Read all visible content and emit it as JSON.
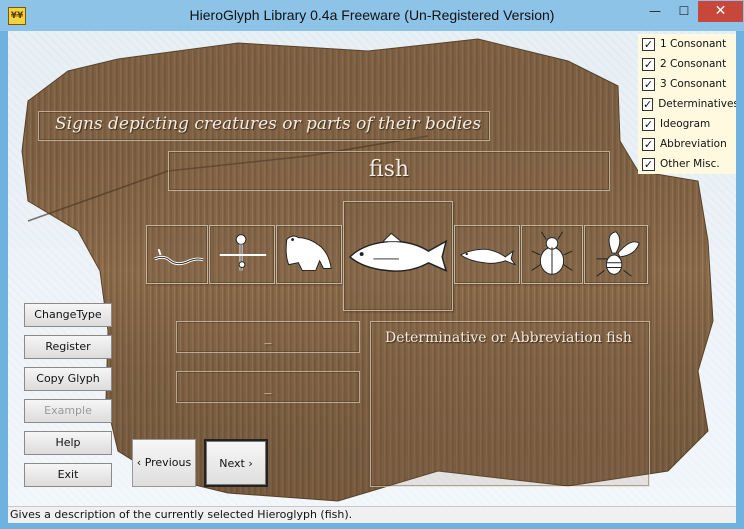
{
  "window": {
    "title": "HieroGlyph Library 0.4a Freeware (Un-Registered Version)",
    "icon_text": "¥¥",
    "minimize": "—",
    "maximize": "☐",
    "close": "✕"
  },
  "category": {
    "title": "Signs depicting creatures or parts of their bodies"
  },
  "selected": {
    "name": "fish"
  },
  "glyphs": [
    {
      "name": "worm",
      "icon": "worm-glyph-icon"
    },
    {
      "name": "plant-on-stand",
      "icon": "standard-glyph-icon"
    },
    {
      "name": "frog",
      "icon": "frog-glyph-icon"
    },
    {
      "name": "fish",
      "icon": "fish-glyph-icon",
      "selected": true
    },
    {
      "name": "small fish",
      "icon": "small-fish-glyph-icon"
    },
    {
      "name": "scarab beetle",
      "icon": "beetle-glyph-icon"
    },
    {
      "name": "bee",
      "icon": "bee-glyph-icon"
    }
  ],
  "info": {
    "field1": "_",
    "field2": "_",
    "description": "Determinative or Abbreviation fish"
  },
  "filters": [
    {
      "label": "1 Consonant",
      "checked": true
    },
    {
      "label": "2 Consonant",
      "checked": true
    },
    {
      "label": "3 Consonant",
      "checked": true
    },
    {
      "label": "Determinatives",
      "checked": true
    },
    {
      "label": "Ideogram",
      "checked": true
    },
    {
      "label": "Abbreviation",
      "checked": true
    },
    {
      "label": "Other Misc.",
      "checked": true
    }
  ],
  "check_mark": "✓",
  "buttons": {
    "change_type": "ChangeType",
    "register": "Register",
    "copy_glyph": "Copy Glyph",
    "example": "Example",
    "help": "Help",
    "exit": "Exit",
    "previous": "‹ Previous",
    "next": "Next ›"
  },
  "status": {
    "text": "Gives a description of the currently selected Hieroglyph (fish)."
  }
}
